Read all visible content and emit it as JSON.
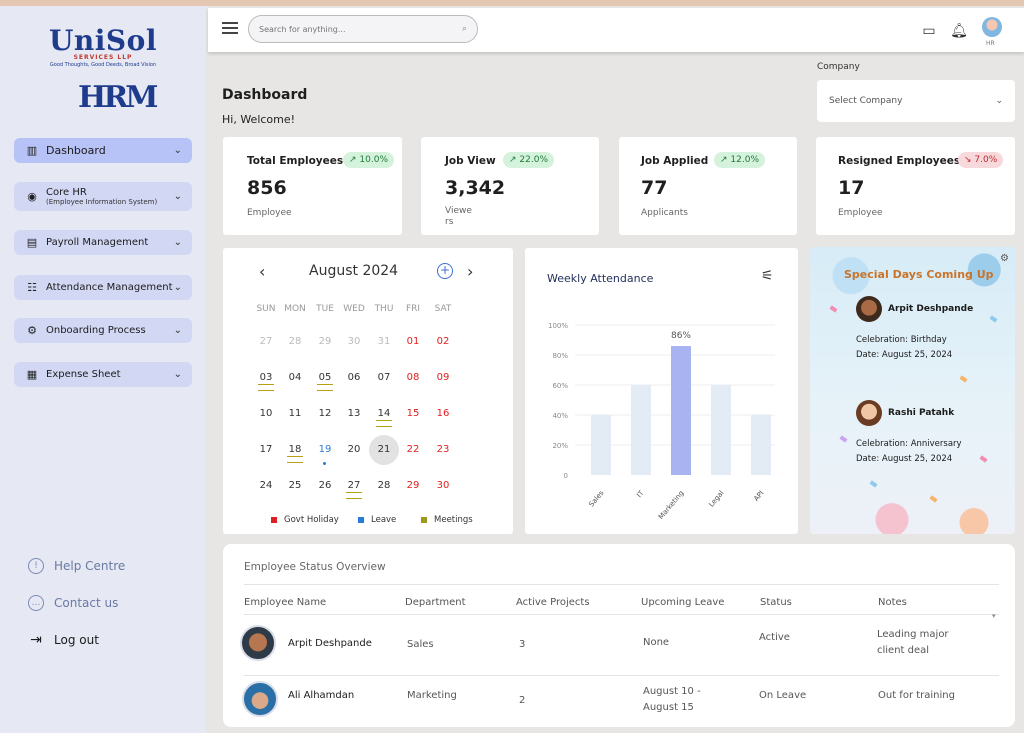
{
  "brand": {
    "logo_main": "UniSol",
    "logo_sub": "SERVICES LLP",
    "logo_tagline": "Good Thoughts, Good Deeds, Broad Vision",
    "product": "HRM"
  },
  "sidebar": {
    "items": [
      {
        "label": "Dashboard",
        "icon": "bar-chart-icon",
        "active": true
      },
      {
        "label": "Core HR",
        "sub": "(Employee Information System)",
        "icon": "user-badge-icon"
      },
      {
        "label": "Payroll Management",
        "icon": "payroll-icon"
      },
      {
        "label": "Attendance Management",
        "icon": "attendance-icon"
      },
      {
        "label": "Onboarding Process",
        "icon": "onboarding-icon"
      },
      {
        "label": "Expense Sheet",
        "icon": "expense-icon"
      }
    ],
    "bottom": [
      {
        "label": "Help Centre",
        "icon": "info-icon"
      },
      {
        "label": "Contact us",
        "icon": "chat-icon"
      },
      {
        "label": "Log out",
        "icon": "logout-icon"
      }
    ]
  },
  "topbar": {
    "search_placeholder": "Search for anything...",
    "user_label": "HR"
  },
  "header": {
    "title": "Dashboard",
    "welcome": "Hi, Welcome!",
    "company_label": "Company",
    "company_select": "Select Company"
  },
  "stats": [
    {
      "title": "Total Employees",
      "change": "10.0%",
      "trend": "up",
      "value": "856",
      "unit": "Employee"
    },
    {
      "title": "Job View",
      "change": "22.0%",
      "trend": "up",
      "value": "3,342",
      "unit": "Viewers"
    },
    {
      "title": "Job Applied",
      "change": "12.0%",
      "trend": "up",
      "value": "77",
      "unit": "Applicants"
    },
    {
      "title": "Resigned Employees",
      "change": "7.0%",
      "trend": "down",
      "value": "17",
      "unit": "Employee"
    }
  ],
  "calendar": {
    "month": "August 2024",
    "days_of_week": [
      "SUN",
      "MON",
      "TUE",
      "WED",
      "THU",
      "FRI",
      "SAT"
    ],
    "weeks": [
      [
        "27",
        "28",
        "29",
        "30",
        "31",
        "01",
        "02"
      ],
      [
        "03",
        "04",
        "05",
        "06",
        "07",
        "08",
        "09"
      ],
      [
        "10",
        "11",
        "12",
        "13",
        "14",
        "15",
        "16"
      ],
      [
        "17",
        "18",
        "19",
        "20",
        "21",
        "22",
        "23"
      ],
      [
        "24",
        "25",
        "26",
        "27",
        "28",
        "29",
        "30"
      ]
    ],
    "selected": "21",
    "legend": [
      {
        "label": "Govt Holiday",
        "color": "#e02020"
      },
      {
        "label": "Leave",
        "color": "#2a7ad8"
      },
      {
        "label": "Meetings",
        "color": "#9a9a18"
      }
    ]
  },
  "chart_data": {
    "type": "bar",
    "title": "Weekly Attendance",
    "categories": [
      "Sales",
      "IT",
      "Marketing",
      "Legal",
      "API"
    ],
    "values": [
      40,
      60,
      86,
      60,
      40
    ],
    "highlight_index": 2,
    "highlight_label": "86%",
    "ylim": [
      0,
      100
    ],
    "yticks": [
      "0",
      "20%",
      "40%",
      "60%",
      "80%",
      "100%"
    ],
    "colors": {
      "bar": "#e3ebf4",
      "highlight": "#aab3f2"
    }
  },
  "special_days": {
    "title": "Special Days Coming Up",
    "people": [
      {
        "name": "Arpit Deshpande",
        "celebration": "Celebration: Birthday",
        "date": "Date: August 25, 2024"
      },
      {
        "name": "Rashi Patahk",
        "celebration": "Celebration: Anniversary",
        "date": "Date: August 25, 2024"
      }
    ]
  },
  "employee_status": {
    "title": "Employee Status Overview",
    "columns": [
      "Employee Name",
      "Department",
      "Active Projects",
      "Upcoming Leave",
      "Status",
      "Notes"
    ],
    "rows": [
      {
        "name": "Arpit Deshpande",
        "department": "Sales",
        "projects": "3",
        "leave": "None",
        "status": "Active",
        "notes": "Leading major client deal"
      },
      {
        "name": "Ali Alhamdan",
        "department": "Marketing",
        "projects": "2",
        "leave": "August 10 - August 15",
        "status": "On Leave",
        "notes": "Out for training"
      }
    ]
  }
}
